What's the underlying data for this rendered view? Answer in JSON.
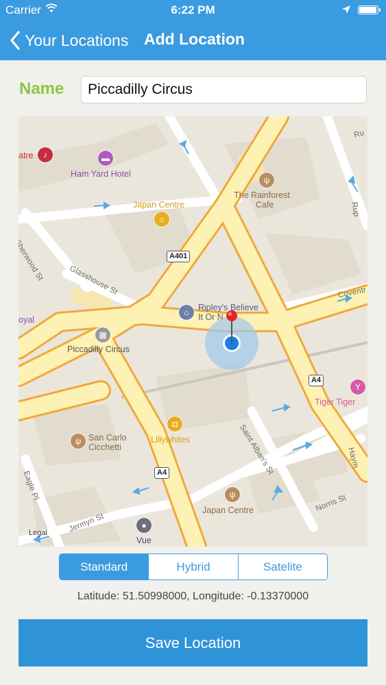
{
  "status_bar": {
    "carrier": "Carrier",
    "time": "6:22 PM",
    "icons": [
      "wifi-icon",
      "location-arrow-icon",
      "battery-icon"
    ],
    "battery_level": 0.95
  },
  "nav": {
    "back_label": "Your Locations",
    "title": "Add Location"
  },
  "form": {
    "name_label": "Name",
    "name_value": "Piccadilly Circus"
  },
  "map": {
    "pois": {
      "theatre": "atre",
      "ham_yard": "Ham Yard Hotel",
      "rainforest_1": "The Rainforest",
      "rainforest_2": "Cafe",
      "japan_centre_top": "Japan Centre",
      "ripleys_1": "Ripley's Believe",
      "ripleys_2": "It Or N",
      "royal": "oyal",
      "piccadilly": "Piccadilly Circus",
      "tiger": "Tiger Tiger",
      "san_carlo_1": "San Carlo",
      "san_carlo_2": "Cicchetti",
      "lillywhites": "Lillywhites",
      "japan_centre_bottom": "Japan Centre",
      "vue": "Vue"
    },
    "streets": {
      "sherwood": "Sherwood St",
      "glasshouse": "Glasshouse St",
      "coventry": "Coventr",
      "st_albans": "Saint Alban's St",
      "eagle": "Eagle Pl",
      "jermyn": "Jermyn St",
      "norris": "Norris St",
      "haymarket": "Haym",
      "rupert_1": "Ru",
      "rupert_2": "Rup"
    },
    "road_shields": {
      "a401": "A401",
      "a4_right": "A4",
      "a4_left": "A4"
    },
    "legal": "Legal",
    "colors": {
      "road_major": "#fdf2b3",
      "road_major_edge": "#f0a83a",
      "road_minor": "#ffffff",
      "land": "#ebe6dc",
      "user_location": "#1a7ee8"
    }
  },
  "map_type": {
    "options": [
      "Standard",
      "Hybrid",
      "Satelite"
    ],
    "selected": "Standard"
  },
  "coordinates_text": "Latitude: 51.50998000, Longitude: -0.13370000",
  "save_label": "Save Location",
  "theme": {
    "accent": "#3b9be0",
    "name_label_color": "#8cc63f"
  }
}
